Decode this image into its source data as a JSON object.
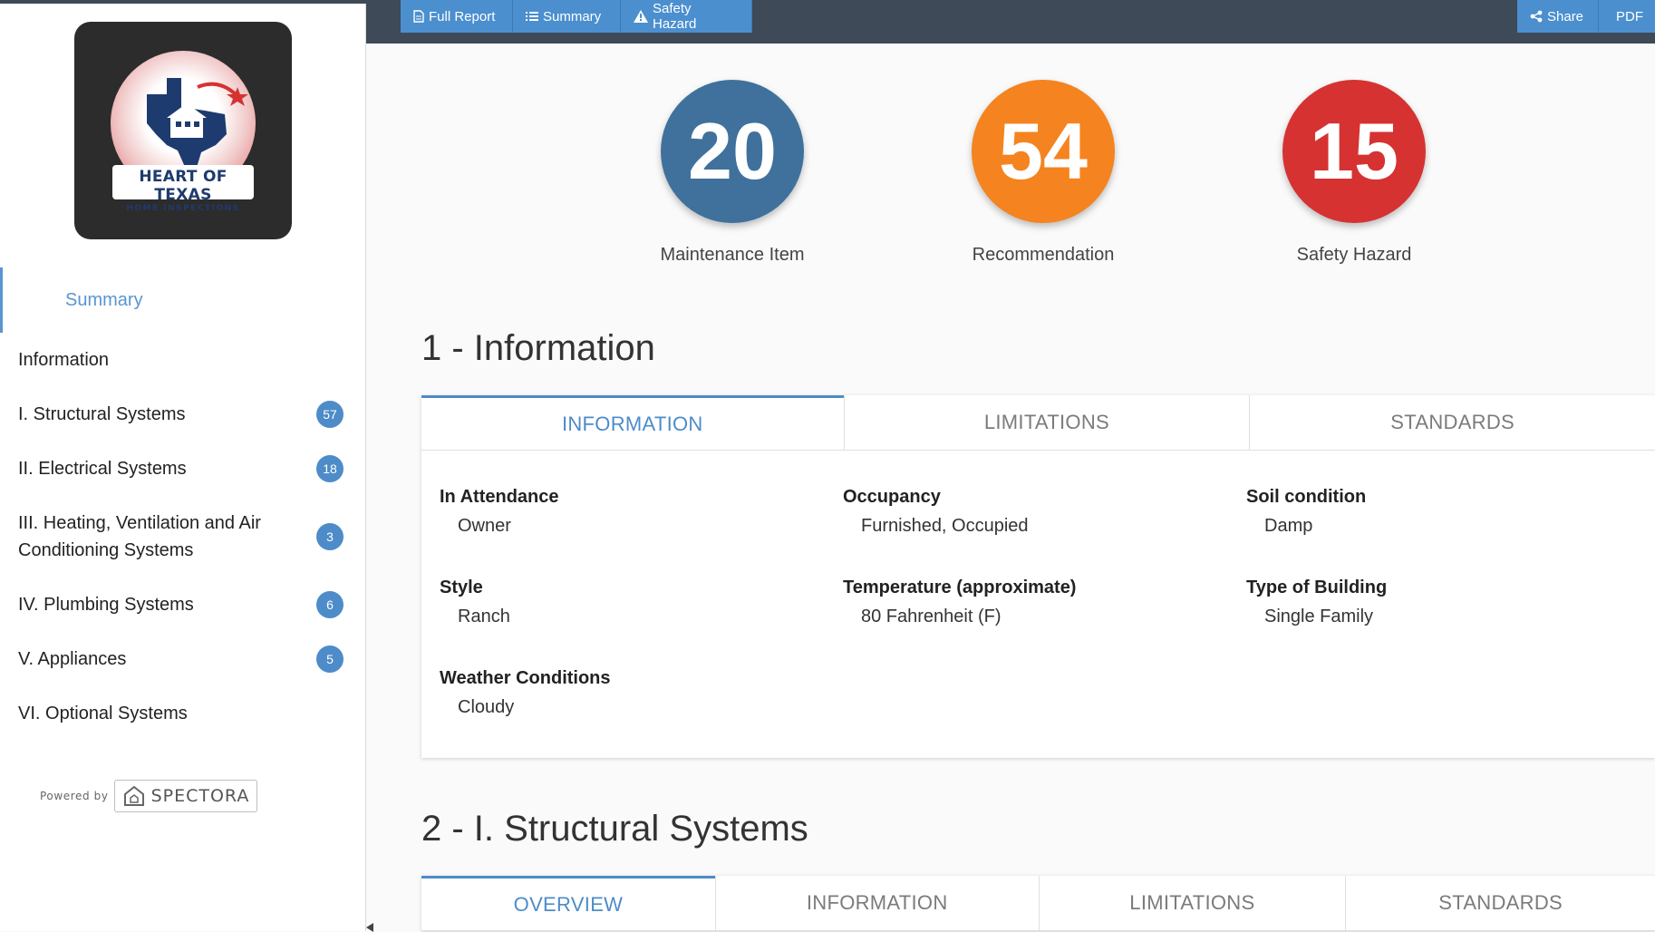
{
  "brand": {
    "title": "HEART OF TEXAS",
    "subtitle": "HOME INSPECTIONS"
  },
  "toolbar": {
    "full_report": "Full Report",
    "summary": "Summary",
    "safety_hazard": "Safety Hazard",
    "share": "Share",
    "pdf": "PDF"
  },
  "sidebar": {
    "items": [
      {
        "label": "Summary",
        "badge": ""
      },
      {
        "label": "Information",
        "badge": ""
      },
      {
        "label": "I. Structural Systems",
        "badge": "57"
      },
      {
        "label": "II. Electrical Systems",
        "badge": "18"
      },
      {
        "label": "III. Heating, Ventilation and Air Conditioning Systems",
        "badge": "3"
      },
      {
        "label": "IV. Plumbing Systems",
        "badge": "6"
      },
      {
        "label": "V. Appliances",
        "badge": "5"
      },
      {
        "label": "VI. Optional Systems",
        "badge": ""
      }
    ],
    "powered_by": "Powered by",
    "powered_brand": "SPECTORA"
  },
  "scores": [
    {
      "count": "20",
      "label": "Maintenance Item",
      "color": "#3f719c"
    },
    {
      "count": "54",
      "label": "Recommendation",
      "color": "#f5831f"
    },
    {
      "count": "15",
      "label": "Safety Hazard",
      "color": "#d63232"
    }
  ],
  "section1": {
    "title": "1 - Information",
    "tabs": [
      "INFORMATION",
      "LIMITATIONS",
      "STANDARDS"
    ],
    "fields": [
      {
        "label": "In Attendance",
        "value": "Owner"
      },
      {
        "label": "Occupancy",
        "value": "Furnished, Occupied"
      },
      {
        "label": "Soil condition",
        "value": "Damp"
      },
      {
        "label": "Style",
        "value": "Ranch"
      },
      {
        "label": "Temperature (approximate)",
        "value": "80 Fahrenheit (F)"
      },
      {
        "label": "Type of Building",
        "value": "Single Family"
      },
      {
        "label": "Weather Conditions",
        "value": "Cloudy"
      }
    ]
  },
  "section2": {
    "title": "2 - I. Structural Systems",
    "tabs": [
      "OVERVIEW",
      "INFORMATION",
      "LIMITATIONS",
      "STANDARDS"
    ]
  }
}
